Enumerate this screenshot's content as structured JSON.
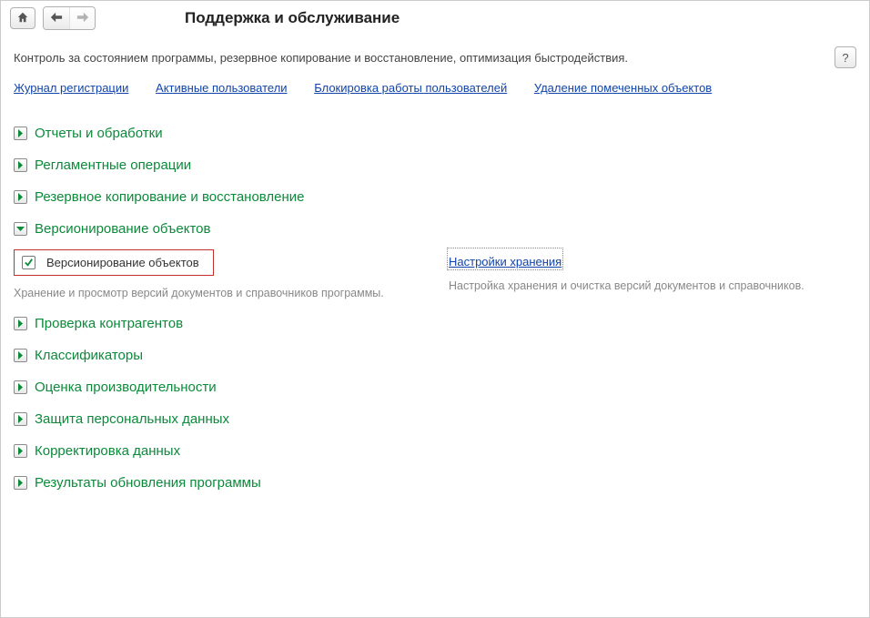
{
  "header": {
    "title": "Поддержка и обслуживание",
    "description": "Контроль за состоянием программы, резервное копирование и восстановление, оптимизация быстродействия.",
    "help_label": "?"
  },
  "top_links": [
    "Журнал регистрации",
    "Активные пользователи",
    "Блокировка работы пользователей",
    "Удаление помеченных объектов"
  ],
  "sections": {
    "reports": "Отчеты и обработки",
    "scheduled": "Регламентные операции",
    "backup": "Резервное копирование и восстановление",
    "versioning": "Версионирование объектов",
    "counterparty": "Проверка контрагентов",
    "classifiers": "Классификаторы",
    "perf": "Оценка производительности",
    "personal": "Защита персональных данных",
    "correction": "Корректировка данных",
    "update": "Результаты обновления программы"
  },
  "versioning": {
    "checkbox_label": "Версионирование объектов",
    "checkbox_checked": true,
    "left_hint": "Хранение и просмотр версий документов и справочников программы.",
    "settings_link": "Настройки хранения",
    "right_hint": "Настройка хранения и очистка версий документов и справочников."
  }
}
